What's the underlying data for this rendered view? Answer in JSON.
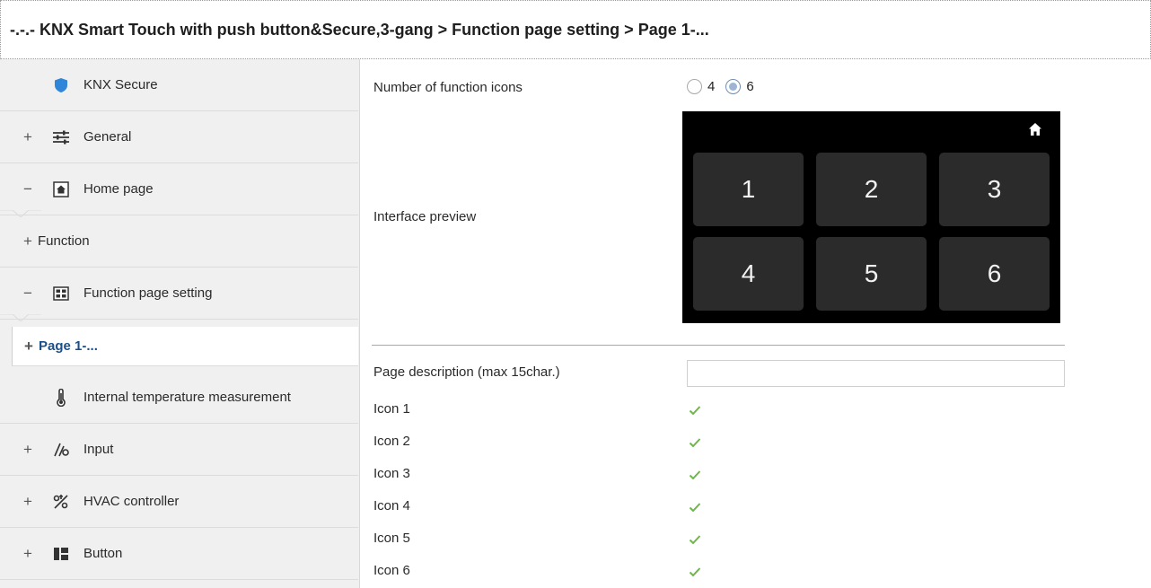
{
  "window": {
    "breadcrumb": "-.-.- KNX Smart Touch with push button&Secure,3-gang > Function page setting > Page 1-..."
  },
  "sidebar": {
    "items": [
      {
        "label": "KNX Secure",
        "expander": "",
        "icon": "shield-icon"
      },
      {
        "label": "General",
        "expander": "+",
        "icon": "sliders-icon"
      },
      {
        "label": "Home page",
        "expander": "−",
        "icon": "home-icon"
      },
      {
        "label": "Function",
        "expander": "+",
        "icon": ""
      },
      {
        "label": "Function page setting",
        "expander": "−",
        "icon": "grid-icon"
      },
      {
        "label": "Page 1-...",
        "expander": "+",
        "icon": ""
      },
      {
        "label": "Internal temperature measurement",
        "expander": "",
        "icon": "thermometer-icon"
      },
      {
        "label": "Input",
        "expander": "+",
        "icon": "input-icon"
      },
      {
        "label": "HVAC controller",
        "expander": "+",
        "icon": "hvac-icon"
      },
      {
        "label": "Button",
        "expander": "+",
        "icon": "button-panel-icon"
      }
    ],
    "selected_index": 5
  },
  "content": {
    "number_of_icons": {
      "label": "Number of  function icons",
      "options": [
        "4",
        "6"
      ],
      "selected": "6"
    },
    "interface_preview": {
      "label": "Interface preview",
      "tiles": [
        "1",
        "2",
        "3",
        "4",
        "5",
        "6"
      ]
    },
    "page_description": {
      "label": "Page description (max 15char.)",
      "value": ""
    },
    "icons": [
      {
        "label": "Icon 1",
        "checked": true
      },
      {
        "label": "Icon 2",
        "checked": true
      },
      {
        "label": "Icon 3",
        "checked": true
      },
      {
        "label": "Icon 4",
        "checked": true
      },
      {
        "label": "Icon 5",
        "checked": true
      },
      {
        "label": "Icon 6",
        "checked": true
      }
    ]
  },
  "colors": {
    "shield": "#2f86d8",
    "check": "#6cb64a",
    "preview_bg": "#000000",
    "tile_bg": "#2b2b2b"
  }
}
